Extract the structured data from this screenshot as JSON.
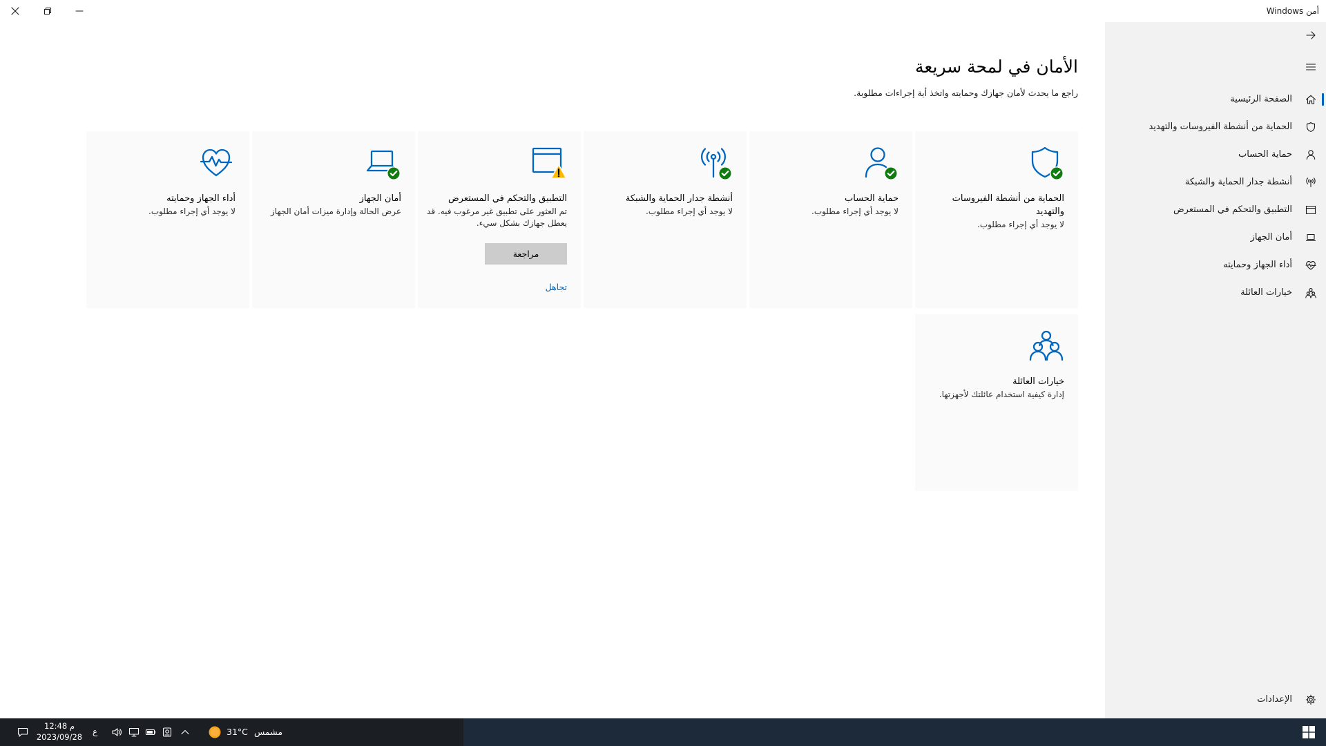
{
  "window": {
    "title": "أمن Windows",
    "controls": {
      "close": "close-icon",
      "restore": "restore-icon",
      "minimize": "minimize-icon"
    }
  },
  "colors": {
    "accent": "#0067c0",
    "ok": "#107c10",
    "warning": "#ffb900",
    "sidebar_bg": "#f2f2f2",
    "taskbar_bg": "#1c2a39"
  },
  "sidebar": {
    "back_icon": "back-arrow-icon",
    "menu_icon": "hamburger-menu-icon",
    "items": [
      {
        "label": "الصفحة الرئيسية",
        "icon": "home-icon",
        "selected": true
      },
      {
        "label": "الحماية من أنشطة الفيروسات والتهديد",
        "icon": "shield-icon",
        "selected": false
      },
      {
        "label": "حماية الحساب",
        "icon": "person-icon",
        "selected": false
      },
      {
        "label": "أنشطة جدار الحماية والشبكة",
        "icon": "antenna-icon",
        "selected": false
      },
      {
        "label": "التطبيق والتحكم في المستعرض",
        "icon": "browser-window-icon",
        "selected": false
      },
      {
        "label": "أمان الجهاز",
        "icon": "laptop-icon",
        "selected": false
      },
      {
        "label": "أداء الجهاز وحمايته",
        "icon": "heart-pulse-icon",
        "selected": false
      },
      {
        "label": "خيارات العائلة",
        "icon": "family-icon",
        "selected": false
      }
    ],
    "settings": {
      "label": "الإعدادات",
      "icon": "gear-icon"
    }
  },
  "main": {
    "title": "الأمان في لمحة سريعة",
    "subtitle": "راجع ما يحدث لأمان جهازك وحمايته واتخذ أية إجراءات مطلوبة.",
    "tiles": [
      {
        "title": "الحماية من أنشطة الفيروسات والتهديد",
        "desc": "لا يوجد أي إجراء مطلوب.",
        "icon": "shield-icon",
        "badge": "check-badge-icon"
      },
      {
        "title": "حماية الحساب",
        "desc": "لا يوجد أي إجراء مطلوب.",
        "icon": "person-icon",
        "badge": "check-badge-icon"
      },
      {
        "title": "أنشطة جدار الحماية والشبكة",
        "desc": "لا يوجد أي إجراء مطلوب.",
        "icon": "antenna-icon",
        "badge": "check-badge-icon"
      },
      {
        "title": "التطبيق والتحكم في المستعرض",
        "desc": "تم العثور على تطبيق غير مرغوب فيه. قد يعطل جهازك بشكل سيء.",
        "icon": "browser-window-icon",
        "badge": "warning-badge-icon",
        "action_label": "مراجعة",
        "dismiss_label": "تجاهل"
      },
      {
        "title": "أمان الجهاز",
        "desc": "عرض الحالة وإدارة ميزات أمان الجهاز",
        "icon": "laptop-icon",
        "badge": "check-badge-icon"
      },
      {
        "title": "أداء الجهاز وحمايته",
        "desc": "لا يوجد أي إجراء مطلوب.",
        "icon": "heart-pulse-icon"
      },
      {
        "title": "خيارات العائلة",
        "desc": "إدارة كيفية استخدام عائلتك لأجهزتها.",
        "icon": "family-icon"
      }
    ]
  },
  "taskbar": {
    "time": "12:48 م",
    "date": "2023/09/28",
    "input_language": "ع",
    "temperature": "31°C",
    "weather": "مشمس",
    "icons": [
      "notification-icon",
      "volume-icon",
      "network-icon",
      "battery-icon",
      "meet-now-icon",
      "chevron-up-icon",
      "sun-icon",
      "windows-start-icon"
    ]
  }
}
